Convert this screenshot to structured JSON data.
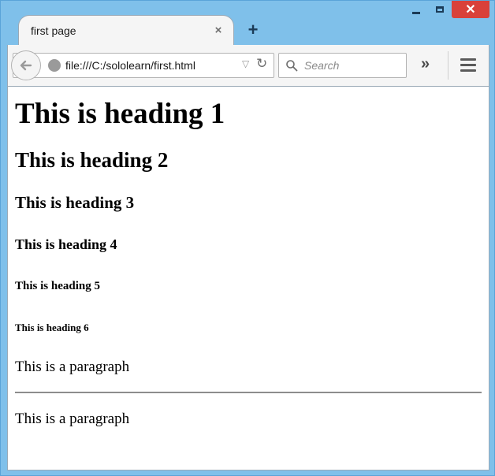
{
  "window": {
    "controls": {
      "minimize": "",
      "maximize": "",
      "close": "✕"
    }
  },
  "tab": {
    "title": "first page",
    "close_label": "×",
    "new_tab_label": "+"
  },
  "navbar": {
    "url": "file:///C:/sololearn/first.html",
    "search_placeholder": "Search",
    "overflow_label": "»"
  },
  "icons": {
    "back": "back-arrow-icon",
    "site": "globe-icon",
    "dropdown": "dropdown-icon",
    "reload": "reload-icon",
    "search": "search-icon",
    "menu": "hamburger-menu-icon"
  },
  "page": {
    "h1": "This is heading 1",
    "h2": "This is heading 2",
    "h3": "This is heading 3",
    "h4": "This is heading 4",
    "h5": "This is heading 5",
    "h6": "This is heading 6",
    "paragraph1": "This is a paragraph",
    "paragraph2": "This is a paragraph"
  },
  "colors": {
    "frame": "#7fc0ea",
    "close_button": "#d9413a",
    "toolbar": "#f5f5f5"
  }
}
